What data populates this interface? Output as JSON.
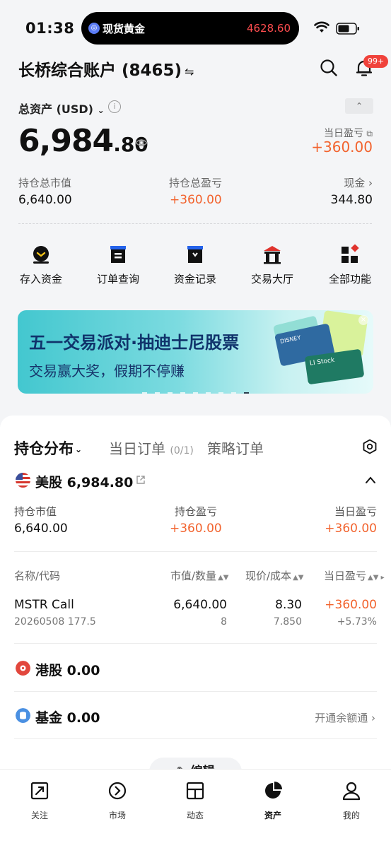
{
  "status_bar": {
    "time": "01:38",
    "ticker_name": "现货黄金",
    "ticker_price": "4628.60"
  },
  "header": {
    "account_name": "长桥综合账户 (8465)",
    "swap_symbol": "⇋",
    "notification_badge": "99+"
  },
  "summary": {
    "total_label": "总资产 (USD)",
    "total_int": "6,984",
    "total_dec": ".80",
    "day_pl_label": "当日盈亏",
    "day_pl_value": "+360.00",
    "market_value_label": "持仓总市值",
    "market_value": "6,640.00",
    "total_pl_label": "持仓总盈亏",
    "total_pl": "+360.00",
    "cash_label": "现金 ›",
    "cash": "344.80"
  },
  "actions": [
    {
      "label": "存入资金",
      "icon": "deposit-icon"
    },
    {
      "label": "订单查询",
      "icon": "order-icon"
    },
    {
      "label": "资金记录",
      "icon": "record-icon"
    },
    {
      "label": "交易大厅",
      "icon": "hall-icon"
    },
    {
      "label": "全部功能",
      "icon": "grid-icon"
    }
  ],
  "banner": {
    "title": "五一交易派对·抽迪士尼股票",
    "subtitle": "交易赢大奖，假期不停赚",
    "card_labels": [
      "DISNEY",
      "LI Stock"
    ]
  },
  "positions": {
    "tabs": {
      "main": "持仓分布",
      "orders": "当日订单",
      "orders_count": "(0/1)",
      "strategy": "策略订单"
    },
    "us": {
      "title": "美股 6,984.80",
      "market_value_label": "持仓市值",
      "market_value": "6,640.00",
      "pl_label": "持仓盈亏",
      "pl": "+360.00",
      "day_pl_label": "当日盈亏",
      "day_pl": "+360.00"
    },
    "columns": {
      "name": "名称/代码",
      "value": "市值/数量",
      "price": "现价/成本",
      "day_pl": "当日盈亏"
    },
    "rows": [
      {
        "name": "MSTR Call",
        "code": "20260508 177.5",
        "value": "6,640.00",
        "qty": "8",
        "price": "8.30",
        "cost": "7.850",
        "day_pl": "+360.00",
        "day_pl_pct": "+5.73%"
      }
    ],
    "hk_title": "港股 0.00",
    "fund_title": "基金 0.00",
    "fund_link": "开通余额通 ›",
    "edit_label": "编辑"
  },
  "bottom_nav": [
    {
      "label": "关注",
      "icon": "watchlist-icon"
    },
    {
      "label": "市场",
      "icon": "market-icon"
    },
    {
      "label": "动态",
      "icon": "feed-icon"
    },
    {
      "label": "资产",
      "icon": "assets-icon",
      "active": true
    },
    {
      "label": "我的",
      "icon": "profile-icon"
    }
  ],
  "colors": {
    "accent_up": "#f2632e",
    "badge": "#f0423b",
    "banner_title": "#10336b"
  }
}
